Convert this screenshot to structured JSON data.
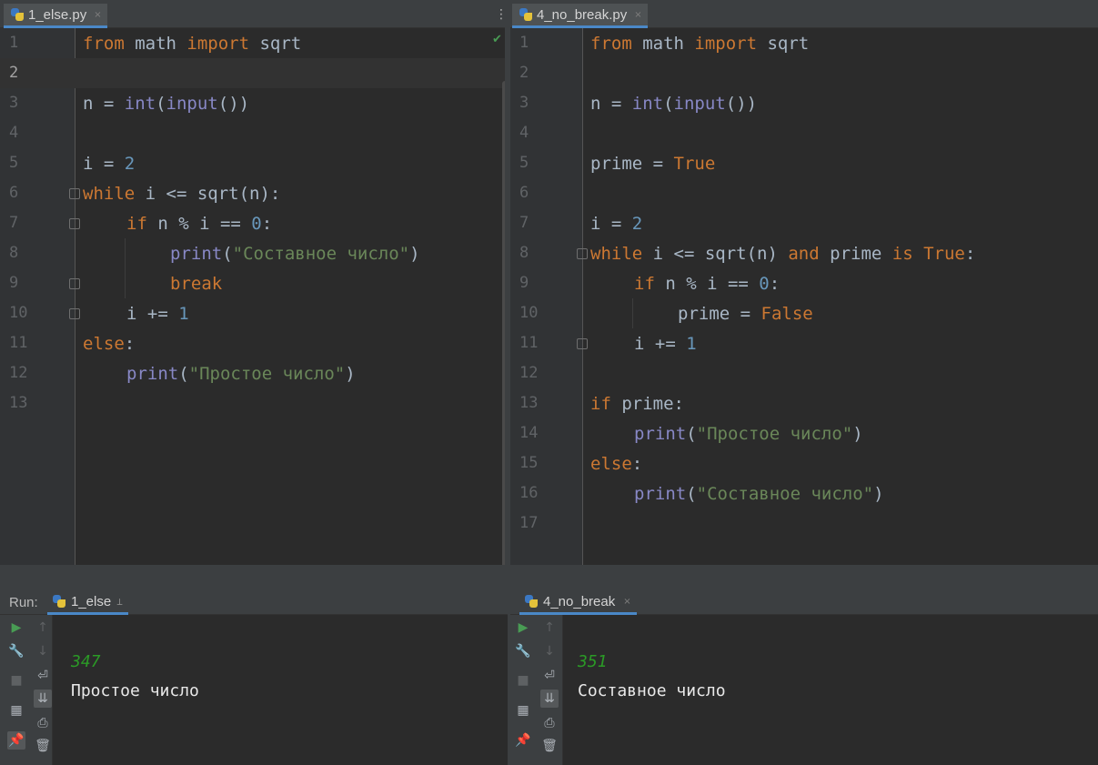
{
  "left_editor": {
    "tab": {
      "label": "1_else.py",
      "close": "×"
    },
    "menu_icon": "⋮",
    "check_icon": "✔",
    "line_numbers": [
      "1",
      "2",
      "3",
      "4",
      "5",
      "6",
      "7",
      "8",
      "9",
      "10",
      "11",
      "12",
      "13"
    ]
  },
  "right_editor": {
    "tab": {
      "label": "4_no_break.py",
      "close": "×"
    },
    "line_numbers": [
      "1",
      "2",
      "3",
      "4",
      "5",
      "6",
      "7",
      "8",
      "9",
      "10",
      "11",
      "12",
      "13",
      "14",
      "15",
      "16",
      "17"
    ]
  },
  "run_panel": {
    "label": "Run:",
    "left_tab": {
      "label": "1_else",
      "pin": "⊥"
    },
    "right_tab": {
      "label": "4_no_break",
      "close": "×"
    },
    "left_output": {
      "input_value": "347",
      "result": "Простое число"
    },
    "right_output": {
      "input_value": "351",
      "result": "Составное число"
    }
  },
  "toolbar_icons": {
    "run": "▶",
    "wrench": "🔧",
    "stop": "■",
    "layout": "▦",
    "pin": "📌",
    "up": "↑",
    "down": "↓",
    "soft_wrap": "⏎",
    "scroll_end": "⇊",
    "print": "⎙",
    "trash": "🗑"
  },
  "colors": {
    "keyword": "#cc7832",
    "builtin": "#8888c6",
    "number": "#6897bb",
    "string": "#6a8759",
    "text": "#a9b7c6",
    "console_number": "#2b9a26",
    "accent": "#4a88c7"
  }
}
